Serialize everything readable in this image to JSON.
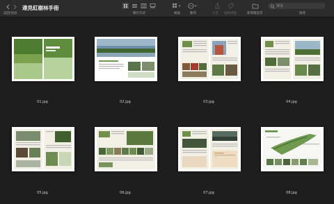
{
  "toolbar": {
    "back_label": "返回/往前",
    "title": "達見紅樹林手冊",
    "view_label": "顯示方式",
    "zoom_label": "縮放",
    "action_label": "動作",
    "share_label": "分享",
    "edit_tags_label": "編輯標籤",
    "new_folder_label": "新增檔案夾",
    "search_label": "搜尋",
    "search_placeholder": "搜尋"
  },
  "files": [
    {
      "name": "01.jpg"
    },
    {
      "name": "02.jpg"
    },
    {
      "name": "03.jpg"
    },
    {
      "name": "04.jpg"
    },
    {
      "name": "05.jpg"
    },
    {
      "name": "06.jpg"
    },
    {
      "name": "07.jpg"
    },
    {
      "name": "08.jpg"
    }
  ],
  "colors": {
    "window_bg": "#1e1e1e",
    "toolbar_bg": "#2c2c2c",
    "accent_green": "#5e8a3f"
  }
}
